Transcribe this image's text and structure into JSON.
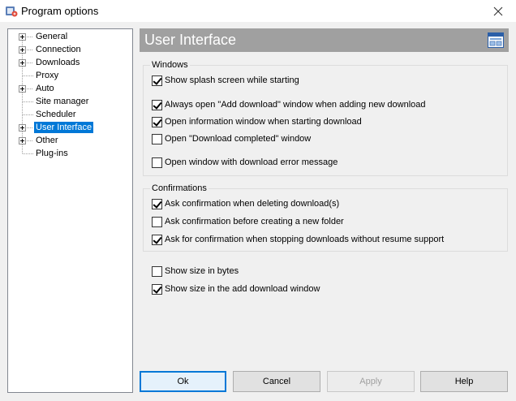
{
  "window": {
    "title": "Program options",
    "close_icon": "close-icon"
  },
  "tree": {
    "items": [
      {
        "label": "General",
        "expandable": true
      },
      {
        "label": "Connection",
        "expandable": true
      },
      {
        "label": "Downloads",
        "expandable": true
      },
      {
        "label": "Proxy",
        "expandable": false
      },
      {
        "label": "Auto",
        "expandable": true
      },
      {
        "label": "Site manager",
        "expandable": false
      },
      {
        "label": "Scheduler",
        "expandable": false
      },
      {
        "label": "User Interface",
        "expandable": true,
        "selected": true
      },
      {
        "label": "Other",
        "expandable": true
      },
      {
        "label": "Plug-ins",
        "expandable": false
      }
    ]
  },
  "panel": {
    "title": "User Interface",
    "header_icon": "window-settings-icon",
    "header_color": "#a0a0a0"
  },
  "windows_group": {
    "legend": "Windows",
    "options": [
      {
        "label": "Show splash screen while starting",
        "checked": true
      },
      {
        "label": "Always open \"Add download\" window when adding new download",
        "checked": true
      },
      {
        "label": "Open information window when starting download",
        "checked": true
      },
      {
        "label": "Open \"Download completed\" window",
        "checked": false
      },
      {
        "label": "Open window with download error message",
        "checked": false
      }
    ]
  },
  "confirm_group": {
    "legend": "Confirmations",
    "options": [
      {
        "label": "Ask confirmation when deleting download(s)",
        "checked": true
      },
      {
        "label": "Ask confirmation before creating a new folder",
        "checked": false
      },
      {
        "label": "Ask for confirmation when stopping downloads without resume support",
        "checked": true
      }
    ]
  },
  "misc_options": [
    {
      "label": "Show size in bytes",
      "checked": false
    },
    {
      "label": "Show size in the add download window",
      "checked": true
    }
  ],
  "buttons": {
    "ok": "Ok",
    "cancel": "Cancel",
    "apply": "Apply",
    "help": "Help"
  },
  "colors": {
    "selection": "#0078d7",
    "default_button_border": "#0078d7"
  }
}
